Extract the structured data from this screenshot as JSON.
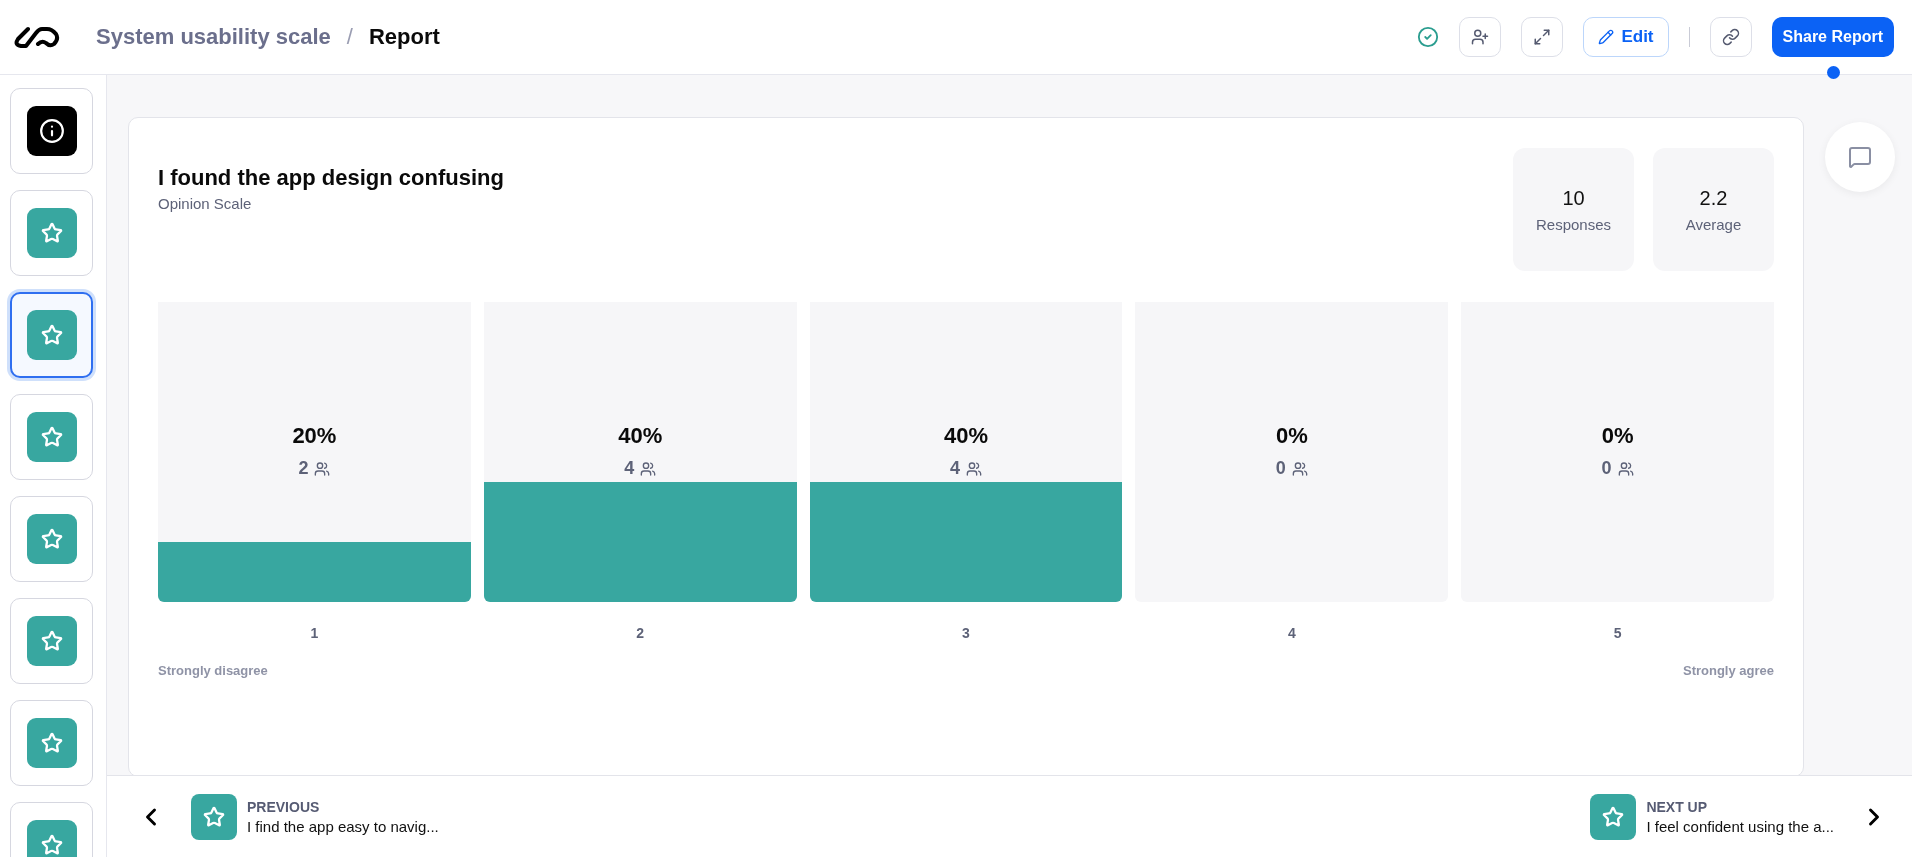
{
  "breadcrumb": {
    "parent": "System usability scale",
    "separator": "/",
    "current": "Report"
  },
  "toolbar": {
    "saved": true,
    "edit": "Edit",
    "share": "Share Report",
    "share_notification": true
  },
  "sidebar": {
    "items": [
      {
        "kind": "info",
        "selected": false
      },
      {
        "kind": "star",
        "selected": false
      },
      {
        "kind": "star",
        "selected": true
      },
      {
        "kind": "star",
        "selected": false
      },
      {
        "kind": "star",
        "selected": false
      },
      {
        "kind": "star",
        "selected": false
      },
      {
        "kind": "star",
        "selected": false
      },
      {
        "kind": "star",
        "selected": false
      }
    ]
  },
  "question": {
    "title": "I found the app design confusing",
    "type": "Opinion Scale",
    "stats": [
      {
        "value": "10",
        "label": "Responses"
      },
      {
        "value": "2.2",
        "label": "Average"
      }
    ],
    "options": [
      {
        "label": "1",
        "percent": "20%",
        "count": "2"
      },
      {
        "label": "2",
        "percent": "40%",
        "count": "4"
      },
      {
        "label": "3",
        "percent": "40%",
        "count": "4"
      },
      {
        "label": "4",
        "percent": "0%",
        "count": "0"
      },
      {
        "label": "5",
        "percent": "0%",
        "count": "0"
      }
    ],
    "scale_min": "Strongly disagree",
    "scale_max": "Strongly agree"
  },
  "navigation": {
    "previous": {
      "heading": "PREVIOUS",
      "text": "I find the app easy to navig..."
    },
    "next": {
      "heading": "NEXT UP",
      "text": "I feel confident using the a..."
    }
  }
}
